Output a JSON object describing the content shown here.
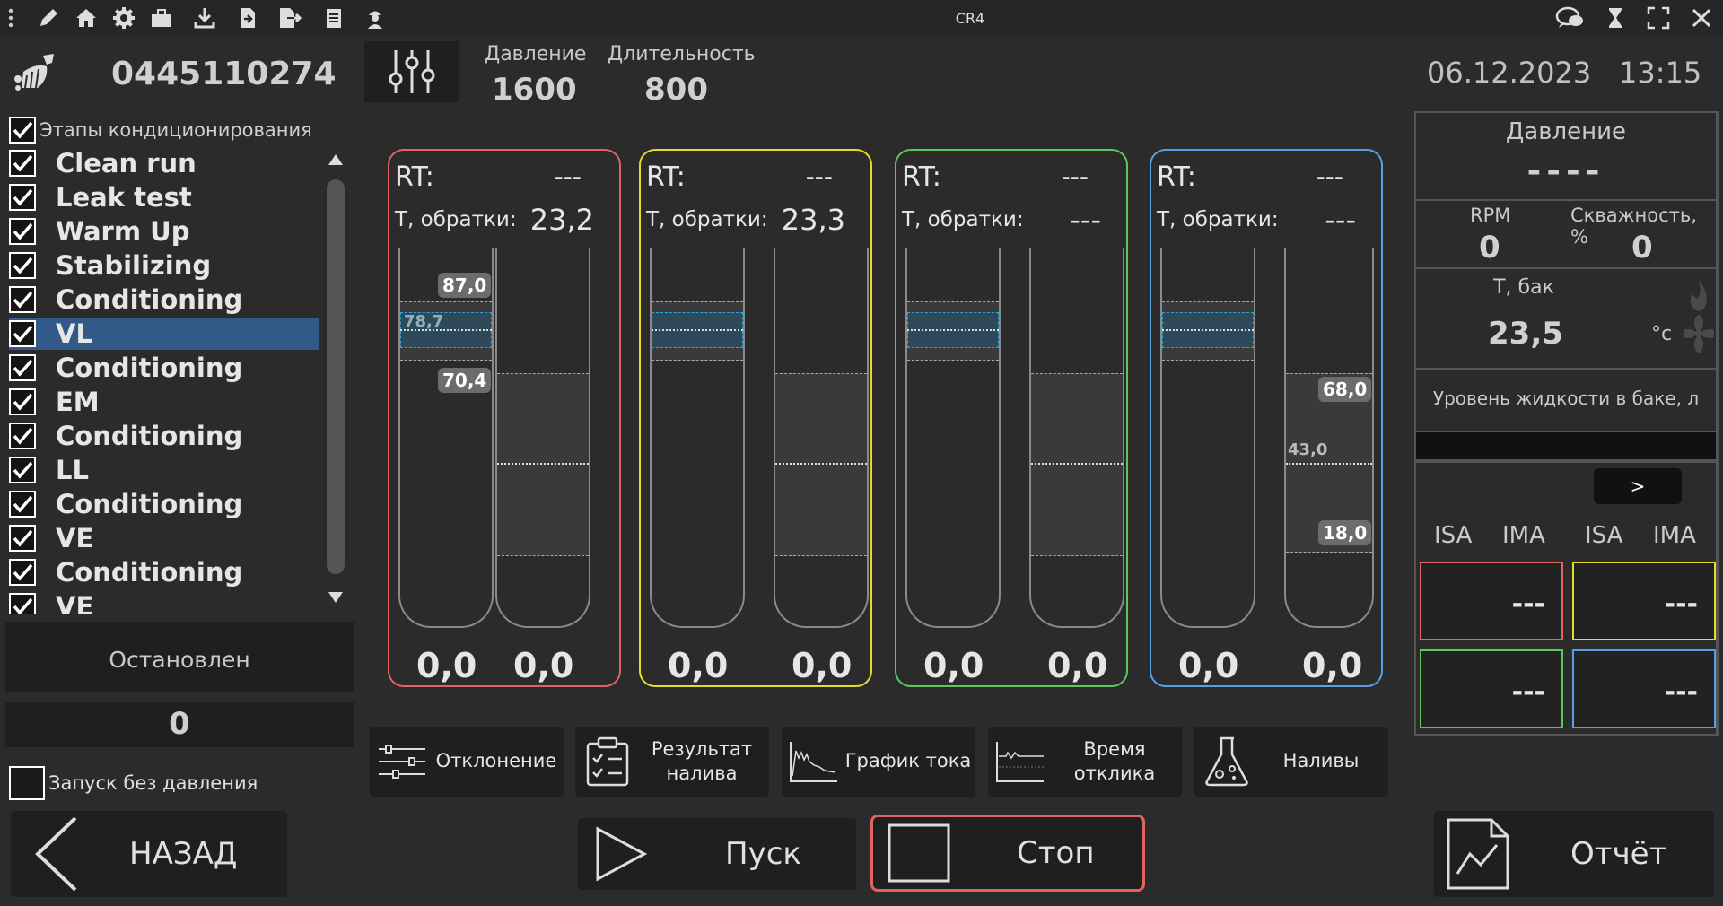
{
  "window_title": "CR4",
  "header": {
    "serial": "0445110274",
    "pressure_label": "Давление",
    "pressure_value": "1600",
    "duration_label": "Длительность",
    "duration_value": "800",
    "date": "06.12.2023",
    "time": "13:15"
  },
  "stages": {
    "title": "Этапы кондиционирования",
    "items": [
      {
        "label": "Clean run",
        "checked": true
      },
      {
        "label": "Leak test",
        "checked": true
      },
      {
        "label": "Warm Up",
        "checked": true
      },
      {
        "label": "Stabilizing",
        "checked": true
      },
      {
        "label": "Conditioning",
        "checked": true
      },
      {
        "label": "VL",
        "checked": true,
        "selected": true
      },
      {
        "label": "Conditioning",
        "checked": true
      },
      {
        "label": "EM",
        "checked": true
      },
      {
        "label": "Conditioning",
        "checked": true
      },
      {
        "label": "LL",
        "checked": true
      },
      {
        "label": "Conditioning",
        "checked": true
      },
      {
        "label": "VE",
        "checked": true
      },
      {
        "label": "Conditioning",
        "checked": true
      },
      {
        "label": "VE",
        "checked": true
      }
    ]
  },
  "status": {
    "state": "Остановлен",
    "count": "0",
    "no_pressure_label": "Запуск без давления"
  },
  "injectors": [
    {
      "color": "#e06464",
      "rt_label": "RT:",
      "rt_value": "---",
      "t_label": "Т, обратки:",
      "t_value": "23,2",
      "left_value": "0,0",
      "right_value": "0,0",
      "tags": {
        "upper": "87,0",
        "mid": "78,7",
        "lower": "70,4"
      }
    },
    {
      "color": "#e6dc28",
      "rt_label": "RT:",
      "rt_value": "---",
      "t_label": "Т, обратки:",
      "t_value": "23,3",
      "left_value": "0,0",
      "right_value": "0,0"
    },
    {
      "color": "#5ac85a",
      "rt_label": "RT:",
      "rt_value": "---",
      "t_label": "Т, обратки:",
      "t_value": "---",
      "left_value": "0,0",
      "right_value": "0,0"
    },
    {
      "color": "#5a9ee6",
      "rt_label": "RT:",
      "rt_value": "---",
      "t_label": "Т, обратки:",
      "t_value": "---",
      "left_value": "0,0",
      "right_value": "0,0",
      "tags": {
        "upper": "68,0",
        "mid": "43,0",
        "lower": "18,0"
      }
    }
  ],
  "tools": [
    {
      "label": "Отклонение",
      "icon": "sliders-icon"
    },
    {
      "label": "Результат\nналива",
      "icon": "clipboard-check-icon"
    },
    {
      "label": "График тока",
      "icon": "current-graph-icon"
    },
    {
      "label": "Время\nотклика",
      "icon": "response-time-icon"
    },
    {
      "label": "Наливы",
      "icon": "flask-icon"
    }
  ],
  "right_panel": {
    "pressure_label": "Давление",
    "pressure_value": "----",
    "rpm_label": "RPM",
    "rpm_value": "0",
    "duty_label": "Скважность, %",
    "duty_value": "0",
    "tank_t_label": "Т, бак",
    "tank_t_value": "23,5",
    "tank_t_unit": "°c",
    "level_label": "Уровень жидкости в баке, л",
    "next_label": ">",
    "col_labels": [
      "ISA",
      "IMA",
      "ISA",
      "IMA"
    ],
    "cells": [
      {
        "value": "---",
        "color": "#e06464"
      },
      {
        "value": "---",
        "color": "#e6dc28"
      },
      {
        "value": "---",
        "color": "#5ac85a"
      },
      {
        "value": "---",
        "color": "#5a9ee6"
      }
    ]
  },
  "footer": {
    "back_label": "НАЗАД",
    "start_label": "Пуск",
    "stop_label": "Стоп",
    "report_label": "Отчёт"
  }
}
